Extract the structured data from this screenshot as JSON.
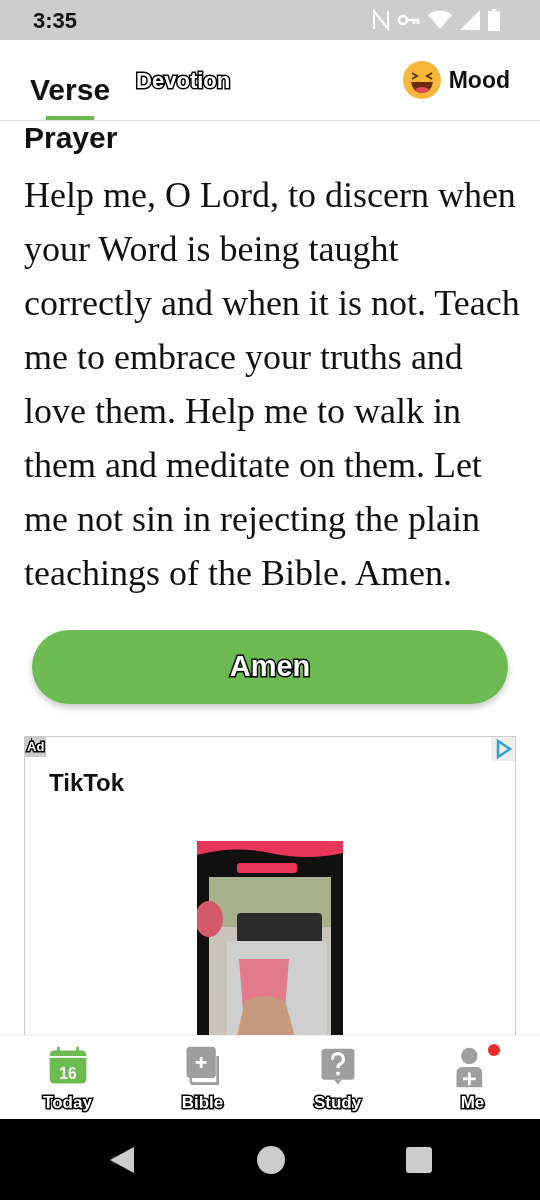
{
  "status_bar": {
    "time": "3:35"
  },
  "tabs": [
    {
      "label": "Verse",
      "selected": true
    },
    {
      "label": "Devotion",
      "selected": false
    }
  ],
  "mood": {
    "label": "Mood"
  },
  "section_title": "Prayer",
  "prayer": "Help me, O Lord, to discern when your Word is being taught correctly and when it is not. Teach me to embrace your truths and love them. Help me to walk in them and meditate on them. Let me not sin in rejecting the plain teachings of the Bible. Amen.",
  "amen_button": "Amen",
  "ad": {
    "badge": "Ad",
    "advertiser": "TikTok",
    "kind": "picture"
  },
  "bottom_nav": [
    {
      "label": "Today",
      "kind": "calendar",
      "day": "16",
      "selected": true,
      "notification": false
    },
    {
      "label": "Bible",
      "kind": "bible",
      "selected": false,
      "notification": false
    },
    {
      "label": "Study",
      "kind": "question",
      "selected": false,
      "notification": false
    },
    {
      "label": "Me",
      "kind": "person",
      "selected": false,
      "notification": true
    }
  ]
}
